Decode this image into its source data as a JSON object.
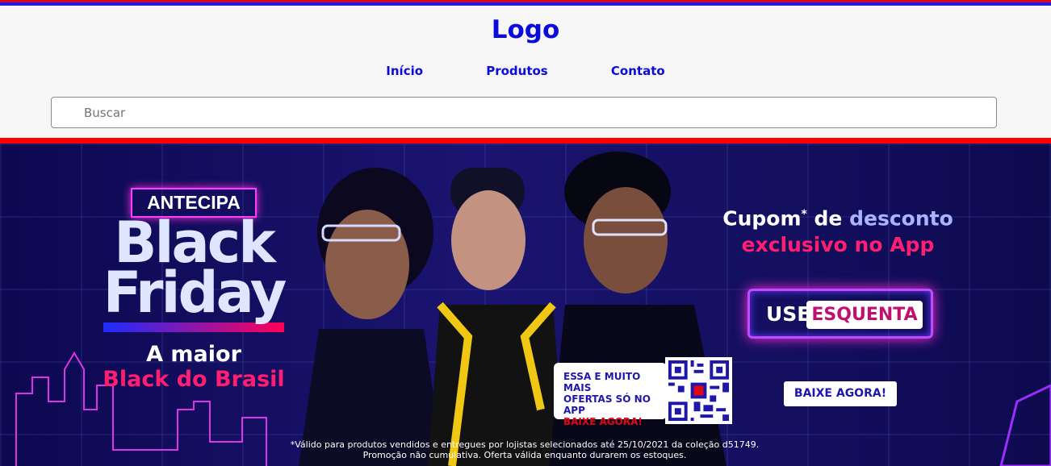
{
  "header": {
    "logo": "Logo",
    "nav": [
      "Início",
      "Produtos",
      "Contato"
    ],
    "search_placeholder": "Buscar"
  },
  "banner": {
    "antecipa": "ANTECIPA",
    "black_friday_line1": "Black",
    "black_friday_line2": "Friday",
    "maior": "A maior",
    "brasil": "Black do Brasil",
    "cupom_line1_a": "Cupom",
    "cupom_star": "*",
    "cupom_line1_b": " de ",
    "cupom_line1_c": "desconto",
    "cupom_line2": "exclusivo no App",
    "use": "USE",
    "code": "ESQUENTA",
    "baixe_button": "BAIXE AGORA!",
    "app_text_1": "ESSA E MUITO MAIS",
    "app_text_2": "OFERTAS SÓ NO APP",
    "app_text_3": "BAIXE AGORA!",
    "disclaimer_1": "*Válido para produtos vendidos e entregues por lojistas selecionados até 25/10/2021 da coleção d51749.",
    "disclaimer_2": "Promoção não cumulativa.  Oferta válida enquanto durarem os estoques."
  },
  "colors": {
    "accent_blue": "#0a0adf",
    "bar_red": "#ff0000",
    "pink": "#ff1e6f"
  }
}
